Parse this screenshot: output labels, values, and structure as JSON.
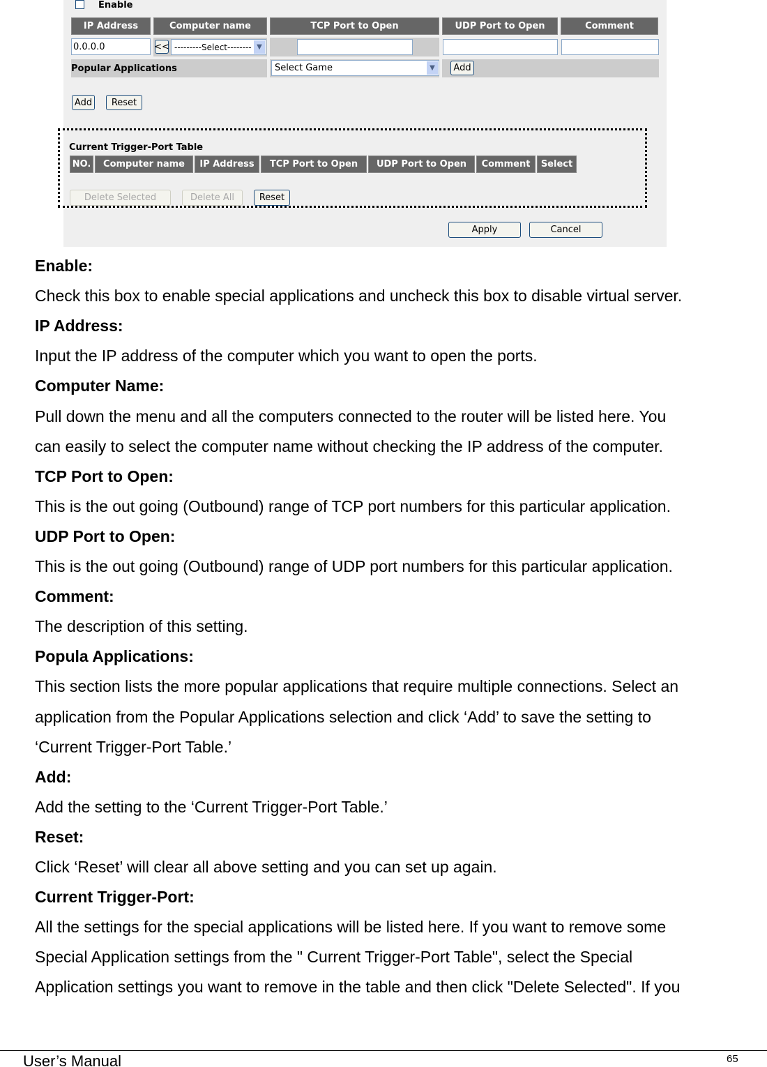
{
  "form": {
    "enable_label": "Enable",
    "enable_checked": false,
    "headers": [
      "IP Address",
      "Computer name",
      "TCP Port to Open",
      "UDP Port to Open",
      "Comment"
    ],
    "ip_value": "0.0.0.0",
    "copy_button": "<<",
    "computer_select": "---------Select--------",
    "popular_label": "Popular Applications",
    "game_select": "Select Game",
    "popular_add": "Add",
    "add": "Add",
    "reset": "Reset"
  },
  "table": {
    "title": "Current Trigger-Port Table",
    "headers": [
      "NO.",
      "Computer name",
      "IP Address",
      "TCP Port to Open",
      "UDP Port to Open",
      "Comment",
      "Select"
    ],
    "delete_selected": "Delete Selected",
    "delete_all": "Delete All",
    "reset": "Reset"
  },
  "actions": {
    "apply": "Apply",
    "cancel": "Cancel"
  },
  "doc": [
    {
      "t": "h",
      "text": "Enable:"
    },
    {
      "t": "p",
      "text": "Check this box to enable special applications and uncheck this box to disable virtual server."
    },
    {
      "t": "h",
      "text": "IP Address:"
    },
    {
      "t": "p",
      "text": "Input the IP address of the computer which you want to open the ports."
    },
    {
      "t": "h",
      "text": "Computer Name:"
    },
    {
      "t": "p",
      "text": "Pull down the menu and all the computers connected to the router will be listed here. You"
    },
    {
      "t": "p",
      "text": "can easily to select the computer name without checking the IP address of the computer."
    },
    {
      "t": "h",
      "text": "TCP Port to Open:"
    },
    {
      "t": "p",
      "text": "This is the out going (Outbound) range of TCP port numbers for this particular application."
    },
    {
      "t": "h",
      "text": "UDP Port to Open:"
    },
    {
      "t": "p",
      "text": "This is the out going (Outbound) range of UDP port numbers for this particular application."
    },
    {
      "t": "h",
      "text": "Comment:"
    },
    {
      "t": "p",
      "text": "The description of this setting."
    },
    {
      "t": "h",
      "text": "Popula Applications:"
    },
    {
      "t": "p",
      "text": "This section lists the more popular applications that require multiple connections. Select an"
    },
    {
      "t": "p",
      "text": "application from the Popular Applications selection and click ‘Add’ to save the setting to"
    },
    {
      "t": "p",
      "text": "‘Current Trigger-Port Table.’"
    },
    {
      "t": "h",
      "text": "Add:"
    },
    {
      "t": "p",
      "text": "Add the setting to the ‘Current Trigger-Port Table.’"
    },
    {
      "t": "h",
      "text": "Reset:"
    },
    {
      "t": "p",
      "text": "Click ‘Reset’ will clear all above setting and you can set up again."
    },
    {
      "t": "h",
      "text": "Current Trigger-Port:"
    },
    {
      "t": "p",
      "text": "All the settings for the special applications will be listed here. If you want to remove some"
    },
    {
      "t": "p",
      "text": "Special Application settings from the \" Current Trigger-Port Table\", select the Special"
    },
    {
      "t": "p",
      "text": "Application settings you want to remove in the table and then click \"Delete Selected\". If you"
    }
  ],
  "footer": {
    "title": "User’s Manual",
    "page": "65"
  }
}
